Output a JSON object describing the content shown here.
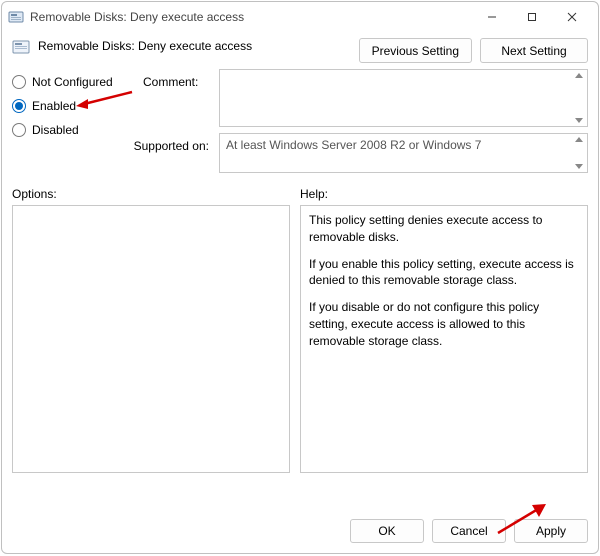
{
  "window": {
    "title": "Removable Disks: Deny execute access"
  },
  "header": {
    "title": "Removable Disks: Deny execute access"
  },
  "nav": {
    "previous": "Previous Setting",
    "next": "Next Setting"
  },
  "state": {
    "not_configured_label": "Not Configured",
    "enabled_label": "Enabled",
    "disabled_label": "Disabled",
    "selected": "enabled"
  },
  "comment": {
    "label": "Comment:",
    "value": ""
  },
  "supported": {
    "label": "Supported on:",
    "value": "At least Windows Server 2008 R2 or Windows 7"
  },
  "panes": {
    "options_label": "Options:",
    "help_label": "Help:"
  },
  "help": {
    "p1": "This policy setting denies execute access to removable disks.",
    "p2": "If you enable this policy setting, execute access is denied to this removable storage class.",
    "p3": "If you disable or do not configure this policy setting, execute access is allowed to this removable storage class."
  },
  "footer": {
    "ok": "OK",
    "cancel": "Cancel",
    "apply": "Apply"
  }
}
